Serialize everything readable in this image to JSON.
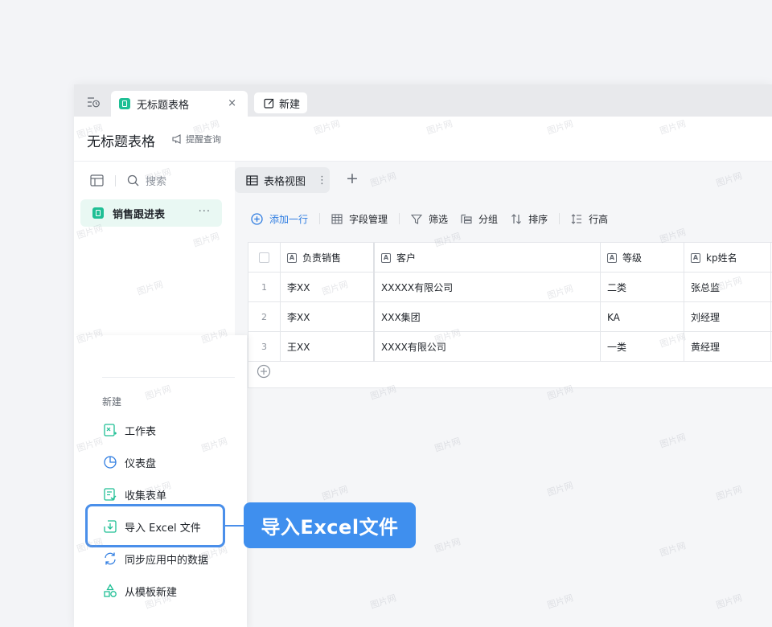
{
  "tabs": {
    "active_title": "无标题表格",
    "close_glyph": "×",
    "new_label": "新建"
  },
  "header": {
    "doc_title": "无标题表格",
    "remind_label": "提醒查询"
  },
  "sidebar": {
    "search_placeholder": "搜索",
    "items": [
      {
        "label": "销售跟进表",
        "more": "···"
      }
    ]
  },
  "new_menu": {
    "heading": "新建",
    "items": [
      {
        "label": "工作表",
        "icon": "worksheet-icon"
      },
      {
        "label": "仪表盘",
        "icon": "dashboard-icon"
      },
      {
        "label": "收集表单",
        "icon": "form-icon"
      },
      {
        "label": "导入 Excel 文件",
        "icon": "import-icon"
      },
      {
        "label": "同步应用中的数据",
        "icon": "sync-icon"
      },
      {
        "label": "从模板新建",
        "icon": "template-icon"
      }
    ]
  },
  "view": {
    "tab_label": "表格视图",
    "tab_more": "⋮",
    "add": "+"
  },
  "toolbar": {
    "add_row": "添加一行",
    "fields": "字段管理",
    "filter": "筛选",
    "group": "分组",
    "sort": "排序",
    "row_height": "行高"
  },
  "table": {
    "columns": [
      "负责销售",
      "客户",
      "等级",
      "kp姓名"
    ],
    "rows": [
      {
        "index": "1",
        "cells": [
          "李XX",
          "XXXXX有限公司",
          "二类",
          "张总监"
        ]
      },
      {
        "index": "2",
        "cells": [
          "李XX",
          "XXX集团",
          "KA",
          "刘经理"
        ]
      },
      {
        "index": "3",
        "cells": [
          "王XX",
          "XXXX有限公司",
          "一类",
          "黄经理"
        ]
      }
    ]
  },
  "callout": {
    "text": "导入Excel文件"
  },
  "watermark_text": "图片网",
  "colors": {
    "accent": "#2f7de1",
    "brand_green": "#1fbf95",
    "callout": "#3f8fee"
  }
}
